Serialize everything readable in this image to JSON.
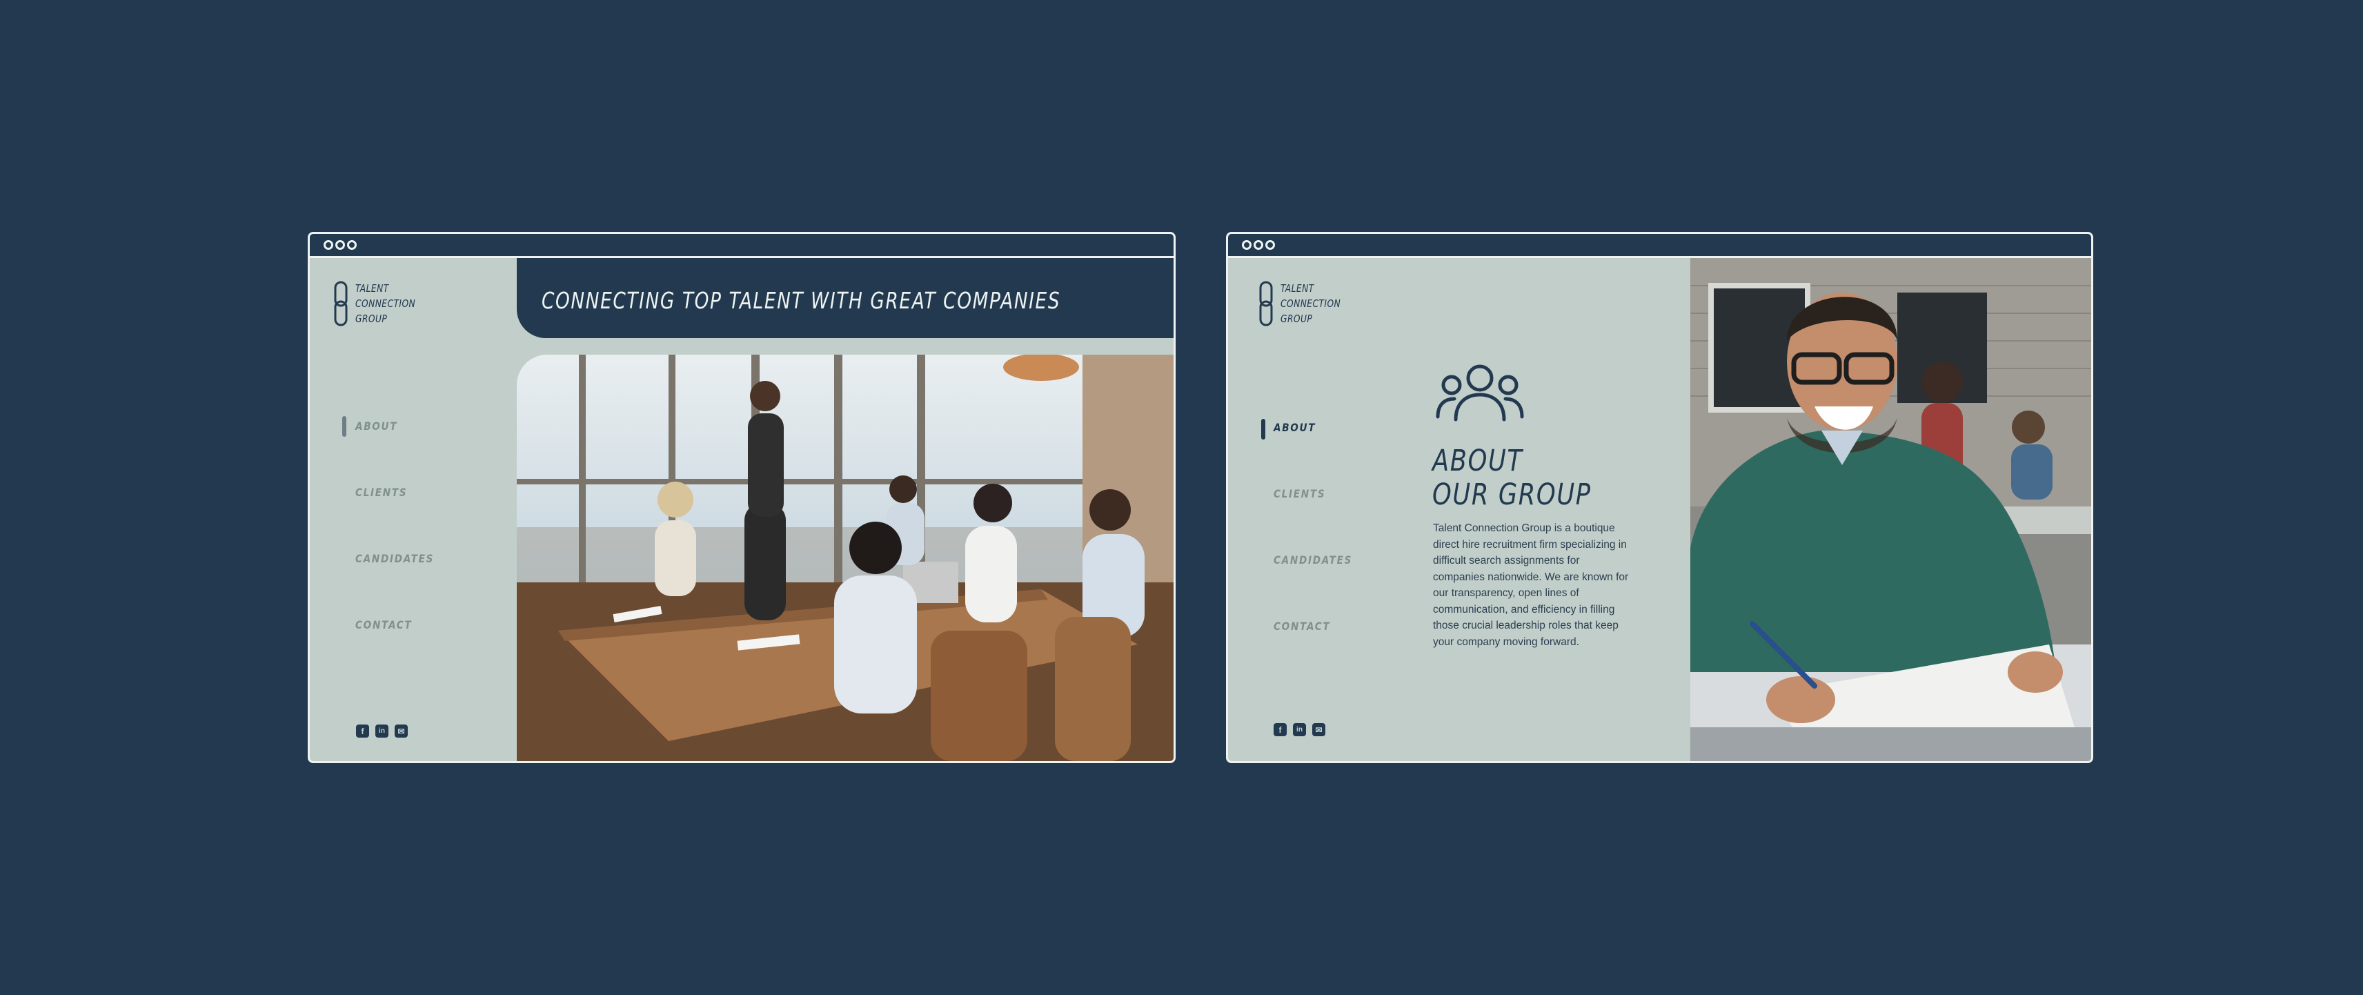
{
  "colors": {
    "background": "#22394f",
    "panel": "#c2ceca",
    "accent_dark": "#22394f",
    "light": "#eef3f2",
    "nav_muted": "#7f908d"
  },
  "brand": {
    "logo_text": "TALENT\nCONNECTION\nGROUP",
    "logo_icon": "chain-link-icon"
  },
  "nav": {
    "items": [
      {
        "label": "ABOUT"
      },
      {
        "label": "CLIENTS"
      },
      {
        "label": "CANDIDATES"
      },
      {
        "label": "CONTACT"
      }
    ]
  },
  "social": {
    "facebook": "f",
    "linkedin": "in",
    "email": "✉"
  },
  "page_home": {
    "hero_title": "CONNECTING TOP TALENT WITH GREAT COMPANIES",
    "hero_image": "team-meeting-photo",
    "active_nav": "ABOUT"
  },
  "page_about": {
    "icon": "group-people-icon",
    "heading": "ABOUT\nOUR GROUP",
    "body": "Talent Connection Group is a boutique direct hire recruitment firm specializing in difficult search assignments for companies nationwide. We are known for our transparency, open lines of communication, and efficiency in filling those crucial leadership roles that keep your company moving forward.",
    "photo": "smiling-man-writing-photo",
    "active_nav": "ABOUT"
  }
}
